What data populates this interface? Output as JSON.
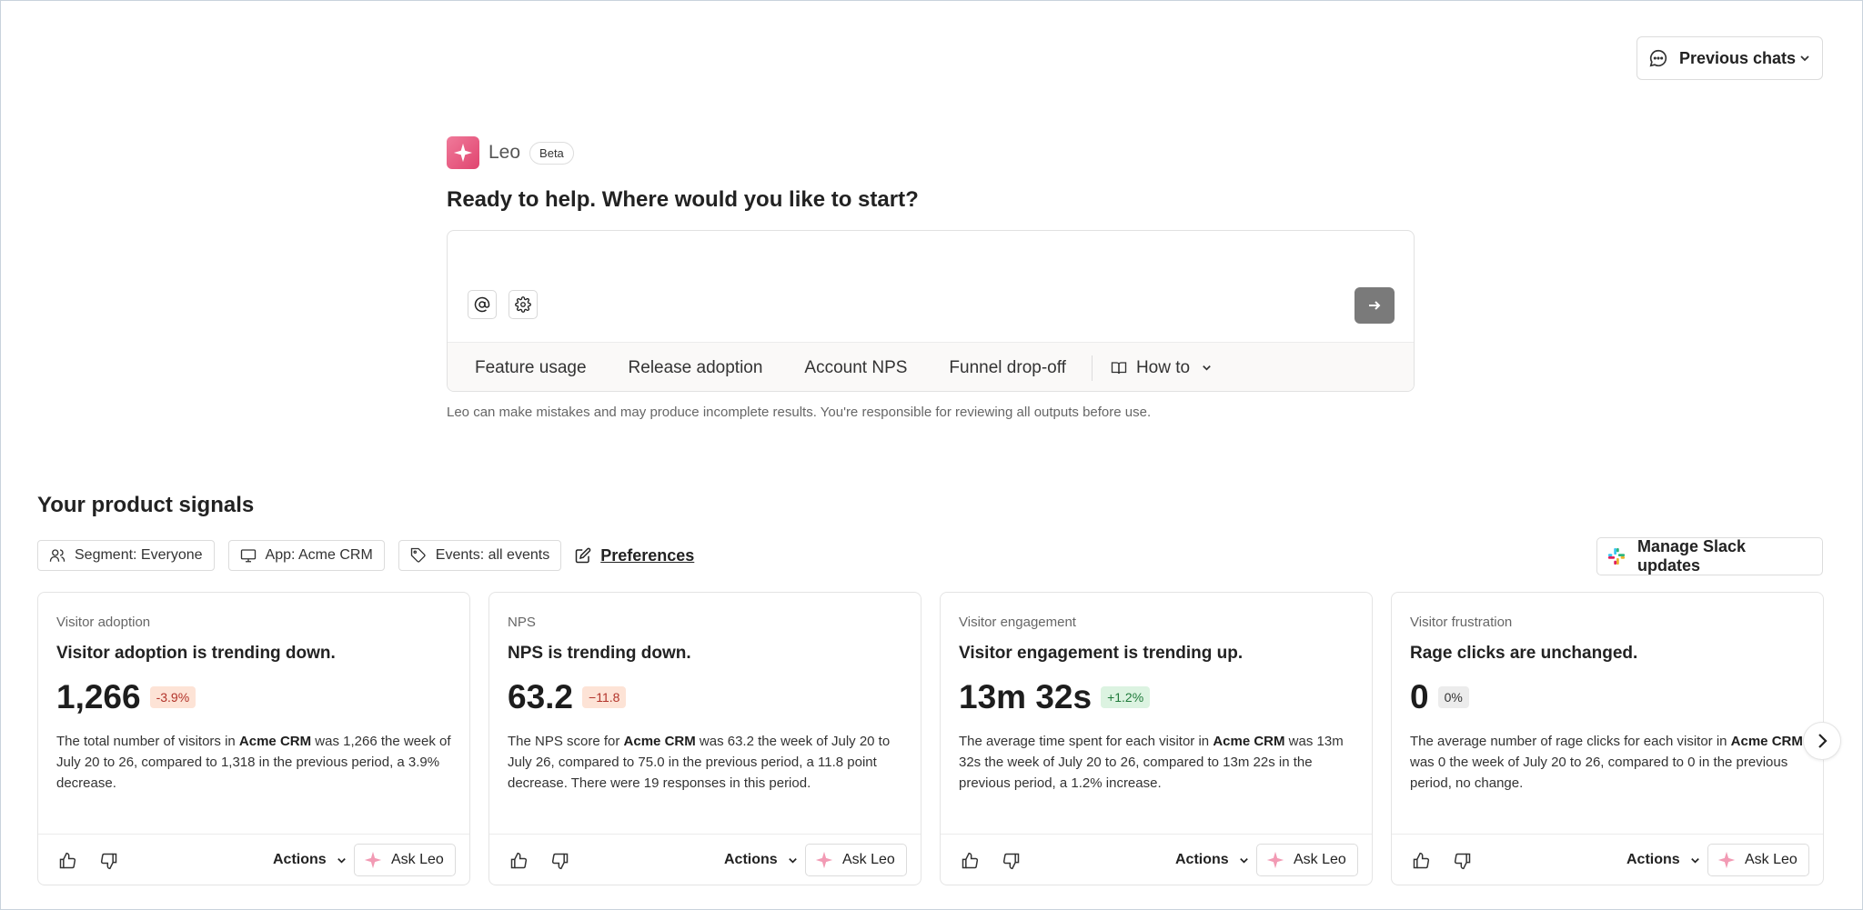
{
  "header": {
    "previous_chats_label": "Previous chats"
  },
  "leo": {
    "name": "Leo",
    "badge": "Beta",
    "headline": "Ready to help. Where would you like to start?",
    "input_placeholder": "",
    "suggestions": [
      "Feature usage",
      "Release adoption",
      "Account NPS",
      "Funnel drop-off"
    ],
    "how_to_label": "How to",
    "disclaimer": "Leo can make mistakes and may produce incomplete results. You're responsible for reviewing all outputs before use."
  },
  "signals": {
    "title": "Your product signals",
    "filters": {
      "segment": "Segment: Everyone",
      "app": "App: Acme CRM",
      "events": "Events: all events"
    },
    "preferences_label": "Preferences",
    "slack_label": "Manage Slack updates",
    "actions_label": "Actions",
    "ask_leo_label": "Ask Leo",
    "cards": [
      {
        "category": "Visitor adoption",
        "title": "Visitor adoption is trending down.",
        "value": "1,266",
        "delta": "-3.9%",
        "delta_kind": "down",
        "desc_parts": [
          "The total number of visitors in ",
          "Acme CRM",
          " was 1,266 the week of July 20 to 26, compared to 1,318 in the previous period, a 3.9% decrease."
        ]
      },
      {
        "category": "NPS",
        "title": "NPS is trending down.",
        "value": "63.2",
        "delta": "−11.8",
        "delta_kind": "down",
        "desc_parts": [
          "The NPS score for ",
          "Acme CRM",
          " was 63.2 the week of July 20 to July 26, compared to 75.0 in the previous period, a 11.8 point decrease. There were 19 responses in this period."
        ]
      },
      {
        "category": "Visitor engagement",
        "title": "Visitor engagement is trending up.",
        "value": "13m 32s",
        "delta": "+1.2%",
        "delta_kind": "up",
        "desc_parts": [
          "The average time spent for each visitor in ",
          "Acme CRM",
          " was 13m 32s the week of July 20 to 26, compared to 13m 22s in the previous period, a 1.2% increase."
        ]
      },
      {
        "category": "Visitor frustration",
        "title": "Rage clicks are unchanged.",
        "value": "0",
        "delta": "0%",
        "delta_kind": "flat",
        "desc_parts": [
          "The average number of rage clicks for each visitor in ",
          "Acme CRM",
          " was 0 the week of July 20 to 26, compared to 0 in the previous period, no change."
        ]
      }
    ]
  },
  "colors": {
    "brand_pink": "#e0446f",
    "send_button": "#7a7a7a",
    "delta_down_bg": "#fde3d6",
    "delta_up_bg": "#dcf3e1"
  }
}
